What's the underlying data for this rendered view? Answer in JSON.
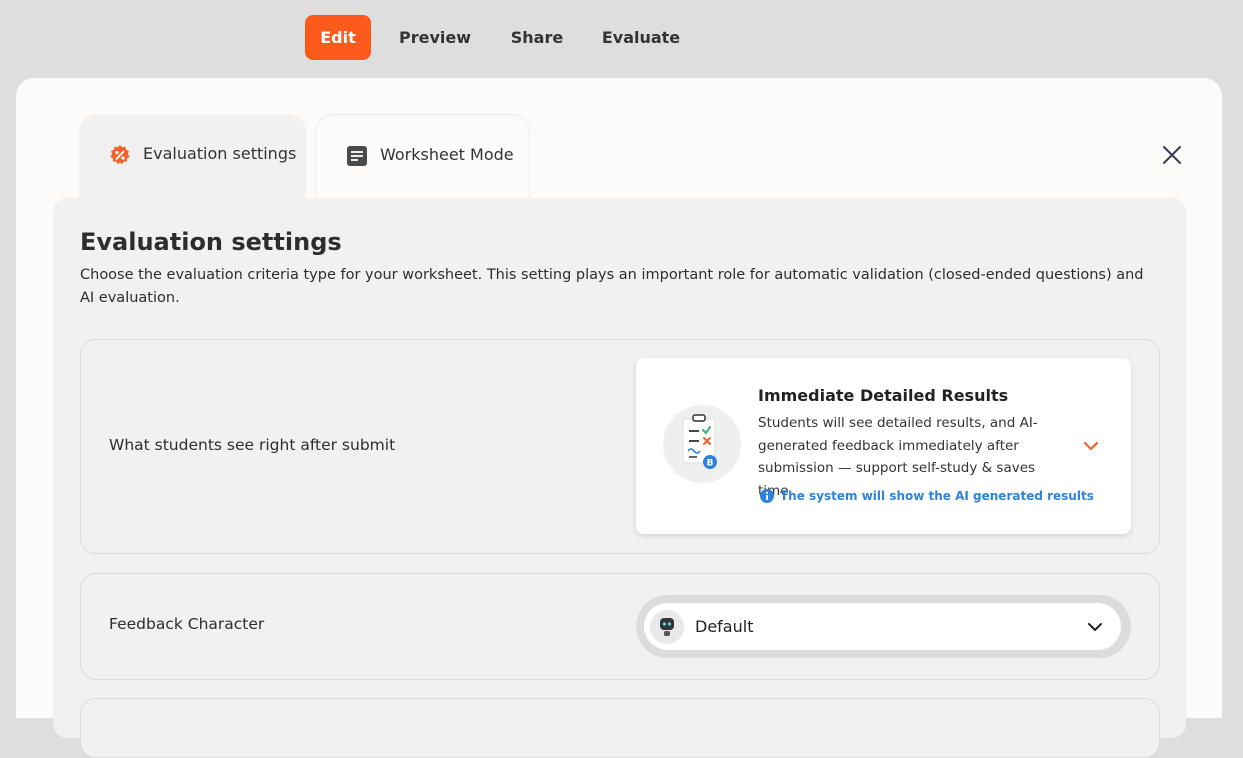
{
  "topnav": {
    "edit": "Edit",
    "preview": "Preview",
    "share": "Share",
    "evaluate": "Evaluate"
  },
  "tabs": [
    {
      "label": "Evaluation settings",
      "icon": "percent-badge-icon",
      "active": true
    },
    {
      "label": "Worksheet Mode",
      "icon": "document-icon",
      "active": false
    }
  ],
  "panel": {
    "title": "Evaluation settings",
    "description": "Choose the evaluation criteria type for your worksheet. This setting plays an important role for automatic validation (closed-ended questions) and AI evaluation."
  },
  "settings": {
    "after_submit": {
      "label": "What students see right after submit",
      "option_title": "Immediate Detailed Results",
      "option_desc": "Students will see detailed results, and AI-generated feedback immediately after submission — support self-study & saves time.",
      "note": "The system will show the AI generated results"
    },
    "feedback_character": {
      "label": "Feedback Character",
      "value": "Default"
    }
  },
  "colors": {
    "accent": "#fb5a1b",
    "info": "#2e84d8"
  }
}
